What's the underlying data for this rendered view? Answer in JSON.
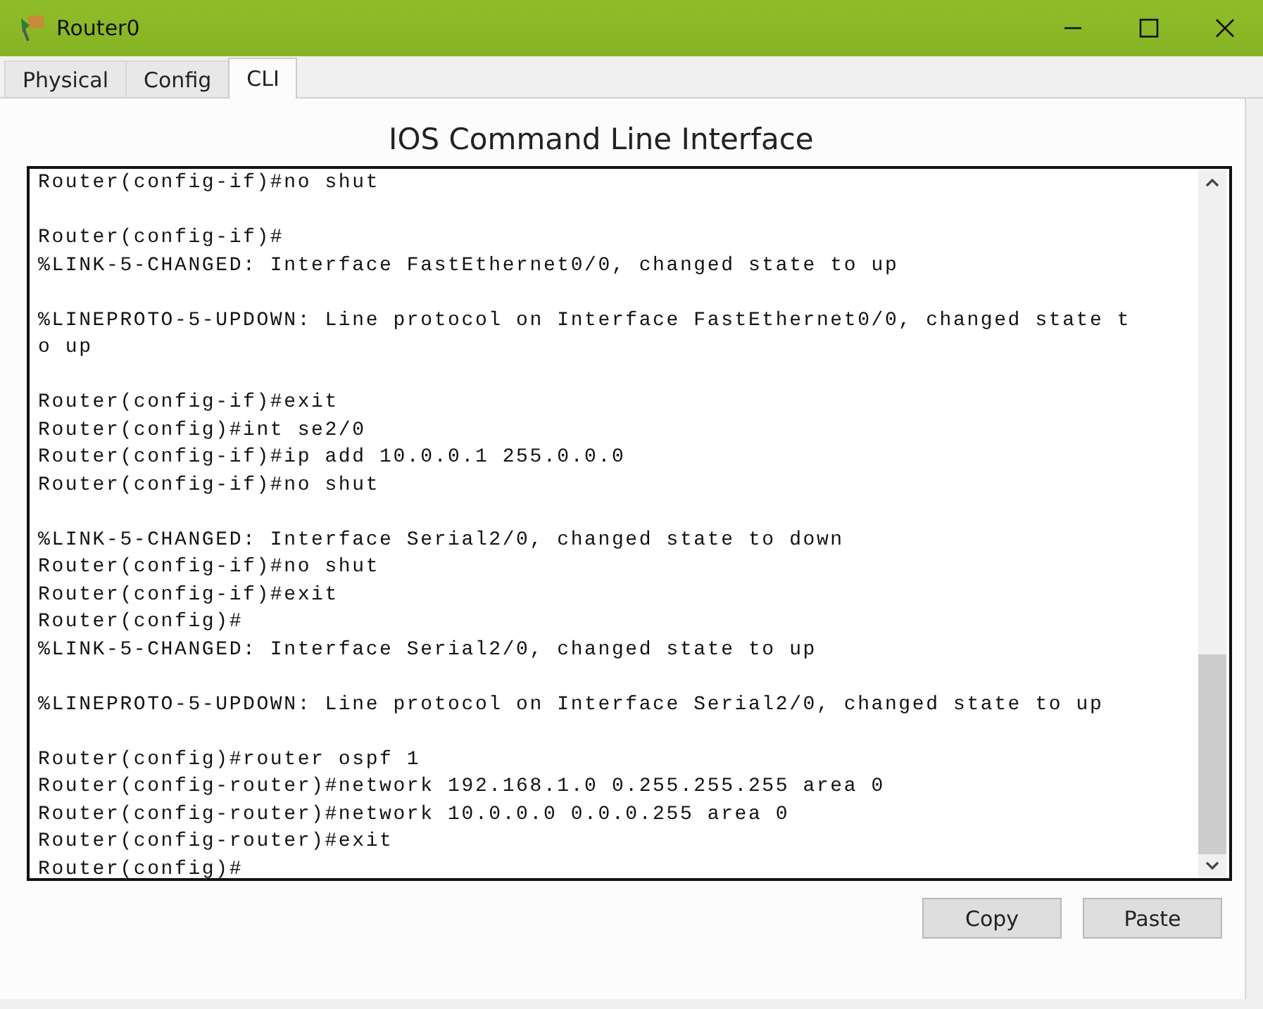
{
  "window": {
    "title": "Router0"
  },
  "tabs": [
    {
      "label": "Physical",
      "selected": false
    },
    {
      "label": "Config",
      "selected": false
    },
    {
      "label": "CLI",
      "selected": true
    }
  ],
  "heading": "IOS Command Line Interface",
  "console": {
    "lines": [
      {
        "kind": "text",
        "text": "Router(config-if)#no shut"
      },
      {
        "kind": "blank"
      },
      {
        "kind": "text",
        "text": "Router(config-if)#"
      },
      {
        "kind": "text",
        "text": "%LINK-5-CHANGED: Interface FastEthernet0/0, changed state to up"
      },
      {
        "kind": "blank"
      },
      {
        "kind": "text",
        "text": "%LINEPROTO-5-UPDOWN: Line protocol on Interface FastEthernet0/0, changed state t"
      },
      {
        "kind": "text",
        "text": "o up"
      },
      {
        "kind": "blank"
      },
      {
        "kind": "text",
        "text": "Router(config-if)#exit"
      },
      {
        "kind": "text",
        "text": "Router(config)#int se2/0"
      },
      {
        "kind": "text",
        "text": "Router(config-if)#ip add 10.0.0.1 255.0.0.0"
      },
      {
        "kind": "text",
        "text": "Router(config-if)#no shut"
      },
      {
        "kind": "blank"
      },
      {
        "kind": "text",
        "text": "%LINK-5-CHANGED: Interface Serial2/0, changed state to down"
      },
      {
        "kind": "text",
        "text": "Router(config-if)#no shut"
      },
      {
        "kind": "text",
        "text": "Router(config-if)#exit"
      },
      {
        "kind": "text",
        "text": "Router(config)#"
      },
      {
        "kind": "text",
        "text": "%LINK-5-CHANGED: Interface Serial2/0, changed state to up"
      },
      {
        "kind": "blank"
      },
      {
        "kind": "text",
        "text": "%LINEPROTO-5-UPDOWN: Line protocol on Interface Serial2/0, changed state to up"
      },
      {
        "kind": "blank"
      },
      {
        "kind": "text",
        "text": "Router(config)#router ospf 1"
      },
      {
        "kind": "text",
        "text": "Router(config-router)#network 192.168.1.0 0.255.255.255 area 0"
      },
      {
        "kind": "text",
        "text": "Router(config-router)#network 10.0.0.0 0.0.0.255 area 0"
      },
      {
        "kind": "text",
        "text": "Router(config-router)#exit"
      },
      {
        "kind": "text",
        "text": "Router(config)#"
      }
    ]
  },
  "buttons": [
    {
      "label": "Copy"
    },
    {
      "label": "Paste"
    }
  ]
}
